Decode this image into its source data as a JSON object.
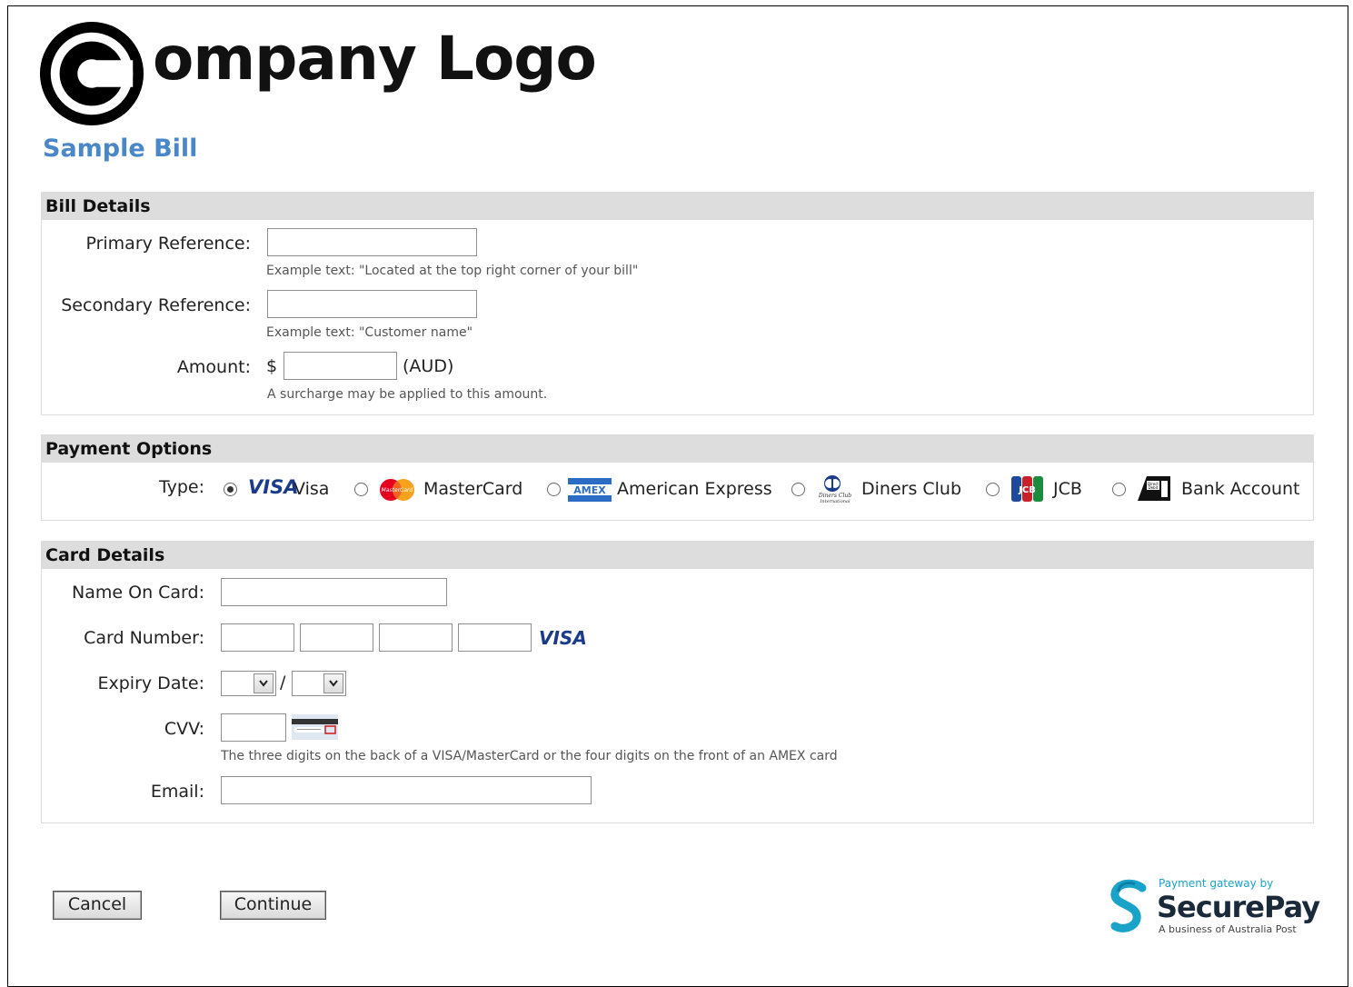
{
  "logo": {
    "text": "ompany Logo"
  },
  "page_title": "Sample Bill",
  "bill_details": {
    "heading": "Bill Details",
    "primary_label": "Primary Reference:",
    "primary_value": "",
    "primary_hint": "Example text: \"Located at the top right corner of your bill\"",
    "secondary_label": "Secondary Reference:",
    "secondary_value": "",
    "secondary_hint": "Example text: \"Customer name\"",
    "amount_label": "Amount:",
    "currency_symbol": "$",
    "amount_value": "",
    "currency_code": "(AUD)",
    "amount_hint": "A surcharge may be applied to this amount."
  },
  "payment_options": {
    "heading": "Payment Options",
    "type_label": "Type:",
    "selected": "Visa",
    "options": [
      {
        "label": "Visa",
        "icon": "visa-icon",
        "logo_text": "VISA"
      },
      {
        "label": "MasterCard",
        "icon": "mastercard-icon",
        "logo_text": "MasterCard"
      },
      {
        "label": "American Express",
        "icon": "amex-icon",
        "logo_text": "AMEX"
      },
      {
        "label": "Diners Club",
        "icon": "diners-club-icon",
        "logo_text": "Diners Club International"
      },
      {
        "label": "JCB",
        "icon": "jcb-icon",
        "logo_text": "JCB"
      },
      {
        "label": "Bank Account",
        "icon": "bank-account-icon",
        "logo_text": "Direct Debit"
      }
    ]
  },
  "card_details": {
    "heading": "Card Details",
    "name_label": "Name On Card:",
    "name_value": "",
    "number_label": "Card Number:",
    "number_parts": [
      "",
      "",
      "",
      ""
    ],
    "card_brand": "VISA",
    "expiry_label": "Expiry Date:",
    "expiry_month": "",
    "expiry_separator": "/",
    "expiry_year": "",
    "cvv_label": "CVV:",
    "cvv_value": "",
    "cvv_hint": "The three digits on the back of a VISA/MasterCard or the four digits on the front of an AMEX card",
    "email_label": "Email:",
    "email_value": ""
  },
  "actions": {
    "cancel_label": "Cancel",
    "continue_label": "Continue"
  },
  "securepay": {
    "tagline": "Payment gateway by",
    "name": "SecurePay",
    "subline": "A business of Australia Post"
  },
  "colors": {
    "title_blue": "#4a87c9",
    "panel_header": "#dddddd",
    "visa_blue": "#1a3a8a",
    "securepay_teal": "#1aa3c9"
  }
}
